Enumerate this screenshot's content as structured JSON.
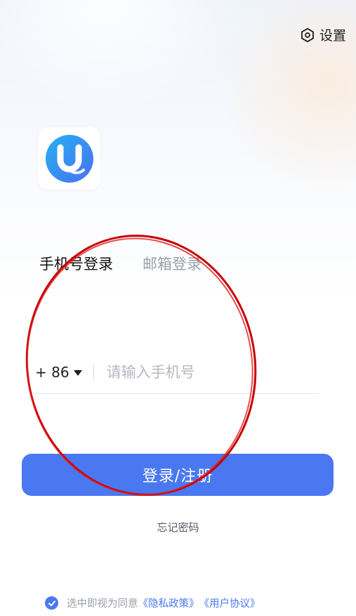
{
  "header": {
    "settings_label": "设置",
    "settings_icon": "settings-hexagon-icon"
  },
  "logo": {
    "icon": "u-app-logo",
    "colors": {
      "gradient_start": "#2aa0f0",
      "gradient_end": "#4a78f0"
    }
  },
  "tabs": [
    {
      "label": "手机号登录",
      "active": true
    },
    {
      "label": "邮箱登录",
      "active": false
    }
  ],
  "phone": {
    "country_code": "+ 86",
    "placeholder": "请输入手机号",
    "value": ""
  },
  "login_button": {
    "label": "登录/注册"
  },
  "forgot_label": "忘记密码",
  "agreement": {
    "checked": true,
    "prefix": "选中即视为同意",
    "privacy_label": "《隐私政策》",
    "terms_label": "《用户协议》"
  },
  "colors": {
    "accent": "#4a78f0",
    "annotation_red": "#d00000"
  }
}
